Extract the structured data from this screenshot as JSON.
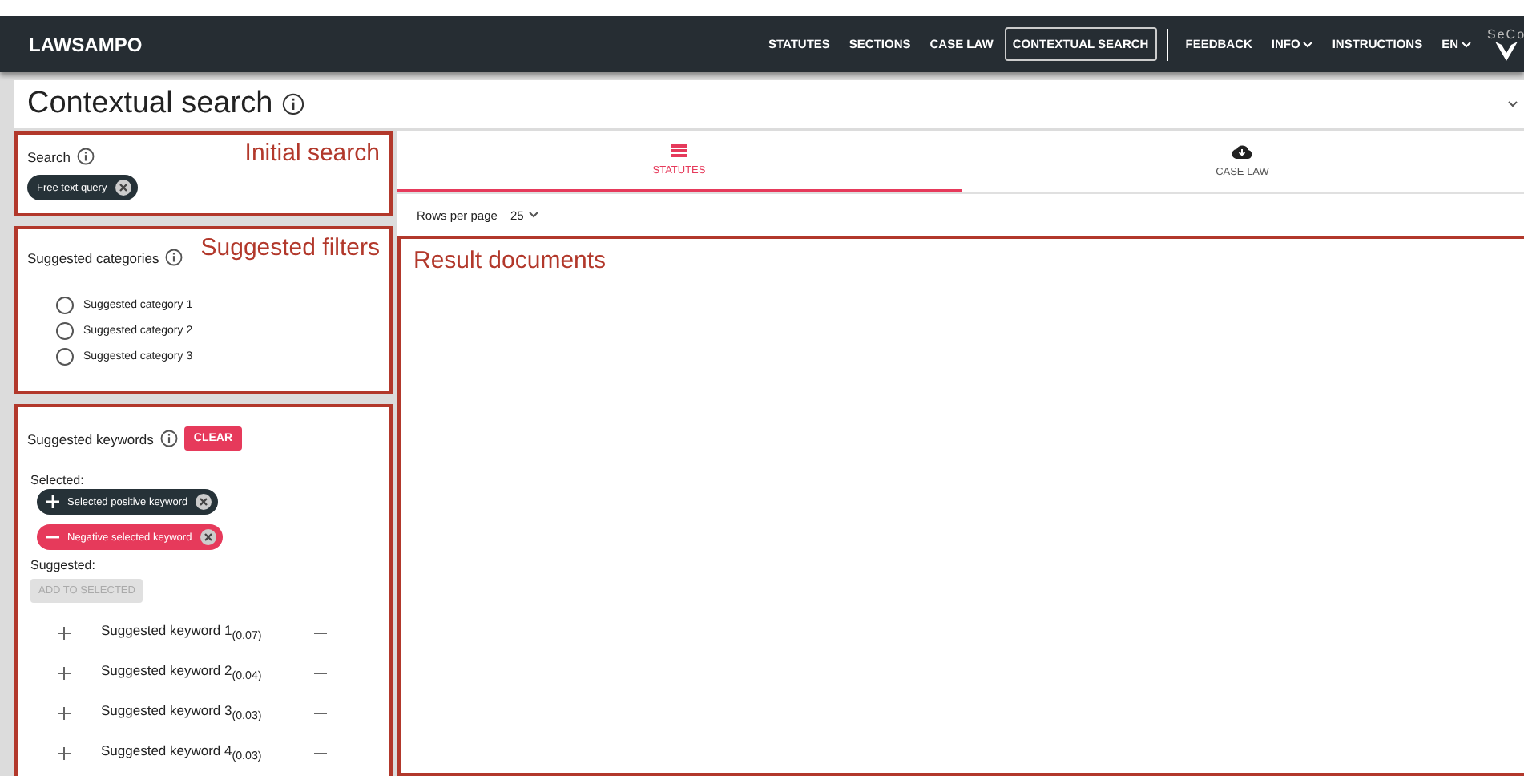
{
  "header": {
    "brand": "LAWSAMPO",
    "nav": [
      {
        "label": "STATUTES",
        "selected": false,
        "dropdown": false
      },
      {
        "label": "SECTIONS",
        "selected": false,
        "dropdown": false
      },
      {
        "label": "CASE LAW",
        "selected": false,
        "dropdown": false
      },
      {
        "label": "CONTEXTUAL SEARCH",
        "selected": true,
        "dropdown": false
      },
      {
        "label": "FEEDBACK",
        "selected": false,
        "dropdown": false
      },
      {
        "label": "INFO",
        "selected": false,
        "dropdown": true
      },
      {
        "label": "INSTRUCTIONS",
        "selected": false,
        "dropdown": false
      },
      {
        "label": "EN",
        "selected": false,
        "dropdown": true
      }
    ],
    "logo_text": "SeCo"
  },
  "page_title": "Contextual search",
  "search": {
    "label": "Search",
    "annotation": "Initial search",
    "chips": [
      "Free text query"
    ]
  },
  "categories": {
    "label": "Suggested categories",
    "annotation": "Suggested filters",
    "options": [
      {
        "label": "Suggested category 1",
        "selected": false
      },
      {
        "label": "Suggested category 2",
        "selected": false
      },
      {
        "label": "Suggested category 3",
        "selected": false
      }
    ]
  },
  "keywords": {
    "label": "Suggested keywords",
    "clear_button": "CLEAR",
    "selected_label": "Selected:",
    "selected": [
      {
        "label": "Selected positive keyword",
        "kind": "positive"
      },
      {
        "label": "Negative selected keyword",
        "kind": "negative"
      }
    ],
    "suggested_label": "Suggested:",
    "add_button": {
      "label": "ADD TO SELECTED",
      "disabled": true
    },
    "suggested": [
      {
        "label": "Suggested keyword 1$_{(0.07)}$"
      },
      {
        "label": "Suggested keyword 2$_{(0.04)}$"
      },
      {
        "label": "Suggested keyword 3$_{(0.03)}$"
      },
      {
        "label": "Suggested keyword 4$_{(0.03)}$"
      }
    ]
  },
  "tabs": [
    {
      "label": "STATUTES",
      "kind": "list",
      "selected": true
    },
    {
      "label": "CASE LAW",
      "kind": "cloud",
      "selected": false
    }
  ],
  "pagination": {
    "label": "Rows per page",
    "value": "25"
  },
  "results": {
    "annotation": "Result documents"
  }
}
